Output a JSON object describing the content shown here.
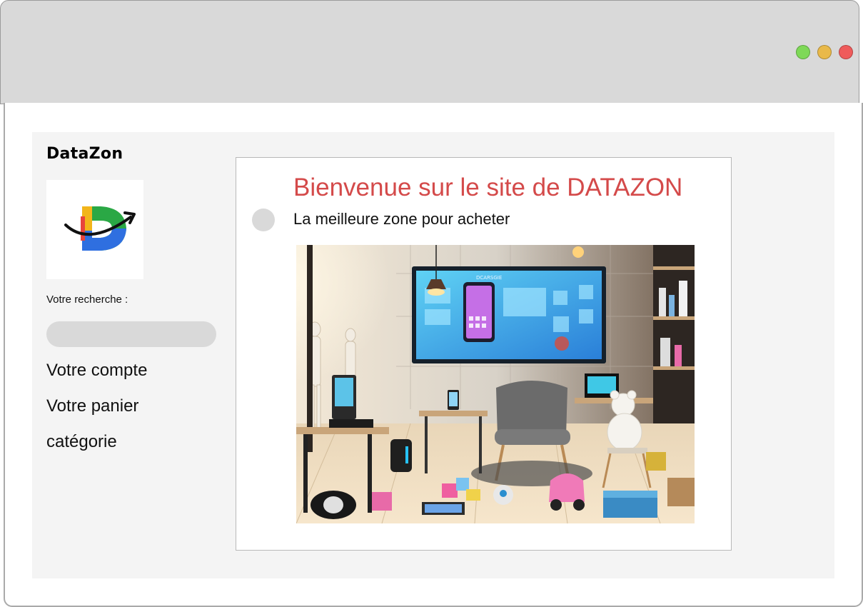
{
  "window": {
    "controls": [
      {
        "name": "maximize",
        "color": "#7ed957"
      },
      {
        "name": "minimize",
        "color": "#e9b949"
      },
      {
        "name": "close",
        "color": "#ef5b5b"
      }
    ]
  },
  "sidebar": {
    "brand": "DataZon",
    "logo": {
      "icon": "datazon-logo-icon",
      "letter": "D"
    },
    "search_label": "Votre recherche :",
    "search_placeholder": "",
    "search_value": "",
    "links": [
      {
        "label": "Votre compte"
      },
      {
        "label": "Votre panier"
      },
      {
        "label": "catégorie"
      }
    ]
  },
  "main": {
    "title": "Bienvenue sur le site de DATAZON",
    "tagline": "La meilleure zone pour acheter",
    "hero_image": {
      "icon": "store-showroom-image",
      "screen_text": "DCARSGIE"
    }
  },
  "colors": {
    "title": "#d44a4a",
    "page_bg": "#f4f4f4",
    "titlebar": "#d9d9d9",
    "input_bg": "#d9d9d9"
  }
}
